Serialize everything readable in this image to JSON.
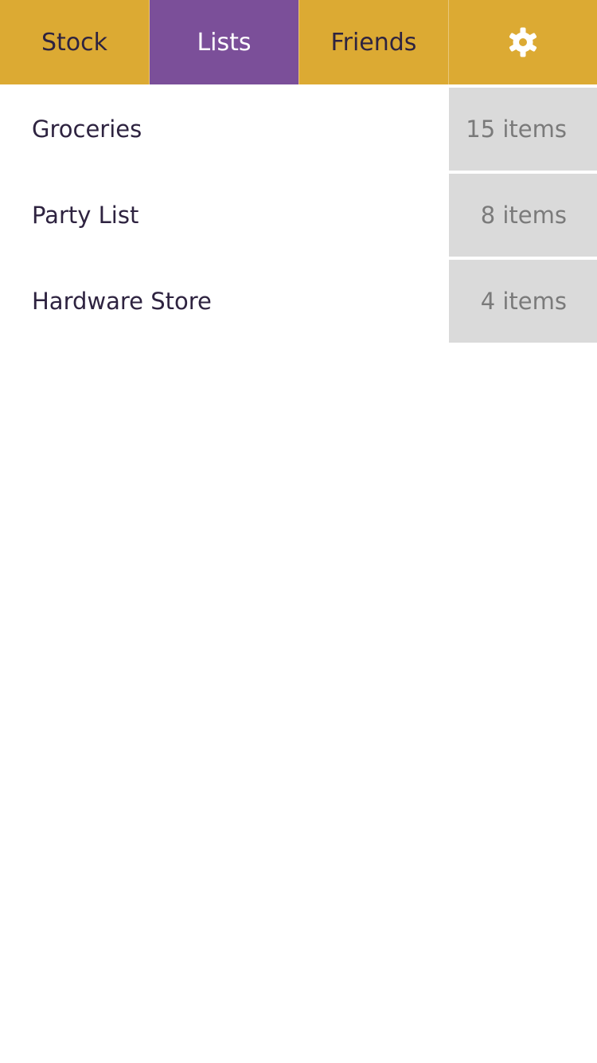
{
  "colors": {
    "tabbar_bg": "#dcaa33",
    "active_tab_bg": "#7b4f99",
    "text_dark": "#2e2340",
    "count_bg": "#dadada",
    "count_text": "#7a7a7a"
  },
  "tabs": [
    {
      "label": "Stock",
      "active": false
    },
    {
      "label": "Lists",
      "active": true
    },
    {
      "label": "Friends",
      "active": false
    }
  ],
  "settings": {
    "icon": "gear-icon"
  },
  "lists": [
    {
      "name": "Groceries",
      "count": "15 items"
    },
    {
      "name": "Party List",
      "count": "8 items"
    },
    {
      "name": "Hardware Store",
      "count": "4 items"
    }
  ]
}
